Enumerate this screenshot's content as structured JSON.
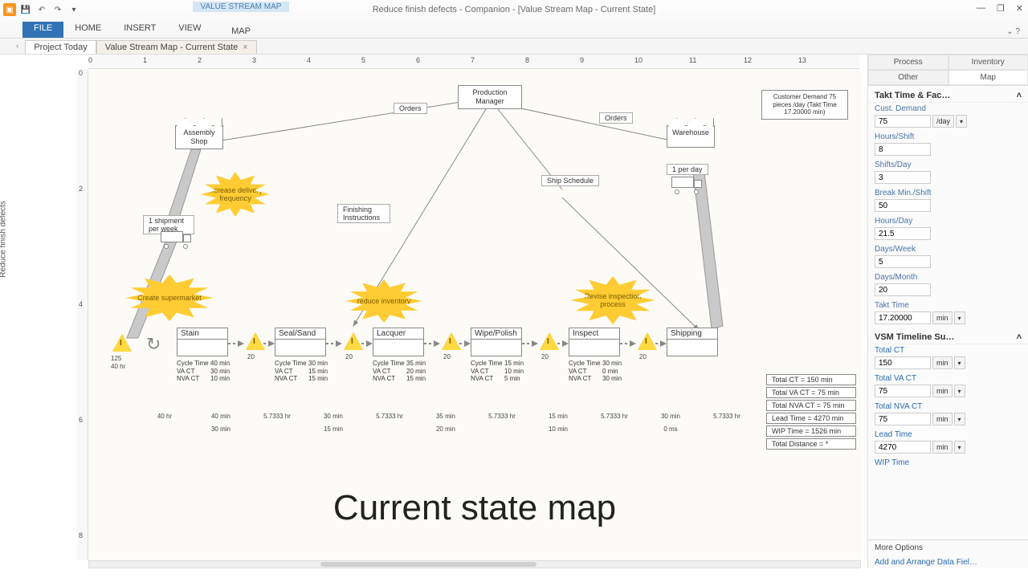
{
  "app": {
    "title": "Reduce finish defects - Companion - [Value Stream Map - Current State]",
    "context_group": "VALUE STREAM MAP",
    "help_hint": "^"
  },
  "qat": [
    "▣",
    "💾",
    "↶",
    "↷",
    "▾"
  ],
  "win": {
    "min": "—",
    "max": "❐",
    "close": "✕"
  },
  "ribbon": {
    "file": "FILE",
    "home": "HOME",
    "insert": "INSERT",
    "view": "VIEW",
    "map": "MAP"
  },
  "doctabs": [
    {
      "label": "Project Today"
    },
    {
      "label": "Value Stream Map - Current State",
      "active": true
    }
  ],
  "ruler_label": "Reduce finish defects",
  "hruler": [
    "0",
    "1",
    "2",
    "3",
    "4",
    "5",
    "6",
    "7",
    "8",
    "9",
    "10",
    "11",
    "12",
    "13"
  ],
  "vruler": [
    "0",
    "",
    "2",
    "",
    "4",
    "",
    "6",
    "",
    "8"
  ],
  "nodes": {
    "pm": "Production\nManager",
    "assembly": "Assembly\nShop",
    "warehouse": "Warehouse",
    "demand": "Customer Demand\n75 pieces /day\n(Takt Time 17.20000\nmin)",
    "orders": "Orders",
    "ship_sched": "Ship Schedule",
    "finish_instr": "Finishing\nInstructions",
    "shipment": "1 shipment\nper week",
    "per_day": "1 per day"
  },
  "bursts": {
    "delivery": "Increase delivery\nfrequency",
    "supermarket": "Create supermarket",
    "inventory": "reduce inventory",
    "inspect": "Revise\ninspection process"
  },
  "first_inv": {
    "qty": "125",
    "time": "40 hr"
  },
  "procs": [
    {
      "name": "Stain",
      "ct": "40 min",
      "va": "30 min",
      "nva": "10 min",
      "inv": "20"
    },
    {
      "name": "Seal/Sand",
      "ct": "30 min",
      "va": "15 min",
      "nva": "15 min",
      "inv": "20"
    },
    {
      "name": "Lacquer",
      "ct": "35 min",
      "va": "20 min",
      "nva": "15 min",
      "inv": "20"
    },
    {
      "name": "Wipe/Polish",
      "ct": "15 min",
      "va": "10 min",
      "nva": "5 min",
      "inv": "20"
    },
    {
      "name": "Inspect",
      "ct": "30 min",
      "va": "0 min",
      "nva": "30 min",
      "inv": "20"
    },
    {
      "name": "Shipping"
    }
  ],
  "proc_labels": {
    "ct": "Cycle Time",
    "va": "VA CT",
    "nva": "NVA CT"
  },
  "summary": [
    "Total CT = 150 min",
    "Total VA CT = 75 min",
    "Total NVA CT = 75 min",
    "Lead Time = 4270 min",
    "WIP Time = 1526 min",
    "Total Distance = *"
  ],
  "timeline": {
    "top": [
      "40 hr",
      "40 min",
      "5.7333 hr",
      "30 min",
      "5.7333 hr",
      "35 min",
      "5.7333 hr",
      "15 min",
      "5.7333 hr",
      "30 min",
      "5.7333 hr"
    ],
    "bot": [
      "",
      "30 min",
      "",
      "15 min",
      "",
      "20 min",
      "",
      "10 min",
      "",
      "0 ms",
      ""
    ]
  },
  "caption": "Current state map",
  "side": {
    "tabs": {
      "process": "Process",
      "inventory": "Inventory",
      "other": "Other",
      "map": "Map"
    },
    "sec1": "Takt Time & Fac…",
    "sec2": "VSM Timeline Su…",
    "fields": {
      "cust_demand": {
        "label": "Cust. Demand",
        "value": "75",
        "unit": "/day"
      },
      "hours_shift": {
        "label": "Hours/Shift",
        "value": "8"
      },
      "shifts_day": {
        "label": "Shifts/Day",
        "value": "3"
      },
      "break": {
        "label": "Break Min./Shift",
        "value": "50"
      },
      "hours_day": {
        "label": "Hours/Day",
        "value": "21.5"
      },
      "days_week": {
        "label": "Days/Week",
        "value": "5"
      },
      "days_month": {
        "label": "Days/Month",
        "value": "20"
      },
      "takt": {
        "label": "Takt Time",
        "value": "17.20000",
        "unit": "min"
      },
      "total_ct": {
        "label": "Total CT",
        "value": "150",
        "unit": "min"
      },
      "total_va": {
        "label": "Total VA CT",
        "value": "75",
        "unit": "min"
      },
      "total_nva": {
        "label": "Total NVA CT",
        "value": "75",
        "unit": "min"
      },
      "lead": {
        "label": "Lead Time",
        "value": "4270",
        "unit": "min"
      },
      "wip": {
        "label": "WIP Time"
      }
    },
    "more": "More Options",
    "link": "Add and Arrange Data Fiel…"
  }
}
